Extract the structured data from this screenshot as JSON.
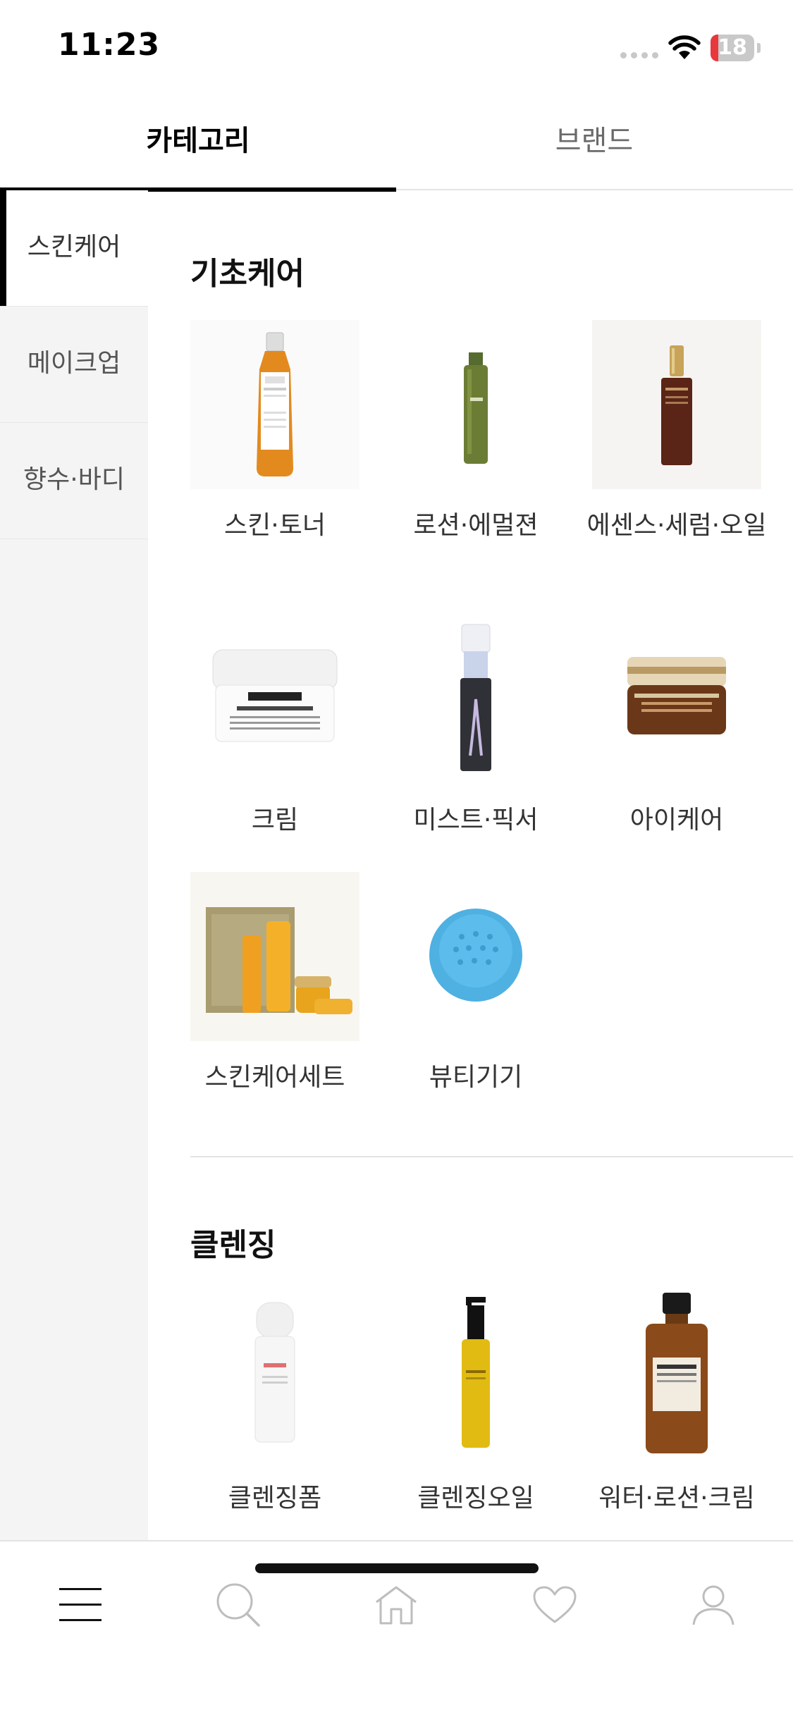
{
  "status_bar": {
    "time": "11:23",
    "battery": "18",
    "battery_level": 0.18
  },
  "top_tabs": [
    {
      "label": "카테고리",
      "active": true
    },
    {
      "label": "브랜드",
      "active": false
    }
  ],
  "sidebar": {
    "items": [
      {
        "label": "스킨케어",
        "active": true
      },
      {
        "label": "메이크업",
        "active": false
      },
      {
        "label": "향수·바디",
        "active": false
      }
    ]
  },
  "sections": [
    {
      "title": "기초케어",
      "items": [
        {
          "label": "스킨·토너",
          "icon": "toner-bottle-image"
        },
        {
          "label": "로션·에멀젼",
          "icon": "lotion-bottle-image"
        },
        {
          "label": "에센스·세럼·오일",
          "icon": "serum-bottle-image"
        },
        {
          "label": "크림",
          "icon": "cream-jar-image"
        },
        {
          "label": "미스트·픽서",
          "icon": "mist-spray-image"
        },
        {
          "label": "아이케어",
          "icon": "eye-cream-jar-image"
        },
        {
          "label": "스킨케어세트",
          "icon": "skincare-set-image"
        },
        {
          "label": "뷰티기기",
          "icon": "beauty-device-image"
        }
      ]
    },
    {
      "title": "클렌징",
      "items": [
        {
          "label": "클렌징폼",
          "icon": "cleansing-foam-image"
        },
        {
          "label": "클렌징오일",
          "icon": "cleansing-oil-image"
        },
        {
          "label": "워터·로션·크림",
          "icon": "cleansing-water-image"
        }
      ]
    }
  ],
  "bottom_nav": [
    {
      "name": "menu",
      "icon": "hamburger-menu-icon",
      "active": true
    },
    {
      "name": "search",
      "icon": "search-icon",
      "active": false
    },
    {
      "name": "home",
      "icon": "home-icon",
      "active": false
    },
    {
      "name": "wishlist",
      "icon": "heart-icon",
      "active": false
    },
    {
      "name": "my-page",
      "icon": "person-icon",
      "active": false
    }
  ],
  "colors": {
    "accent": "#000000",
    "sidebar_bg": "#f4f4f4",
    "inactive_icon": "#bdbdbd",
    "battery_low": "#e8373d"
  }
}
